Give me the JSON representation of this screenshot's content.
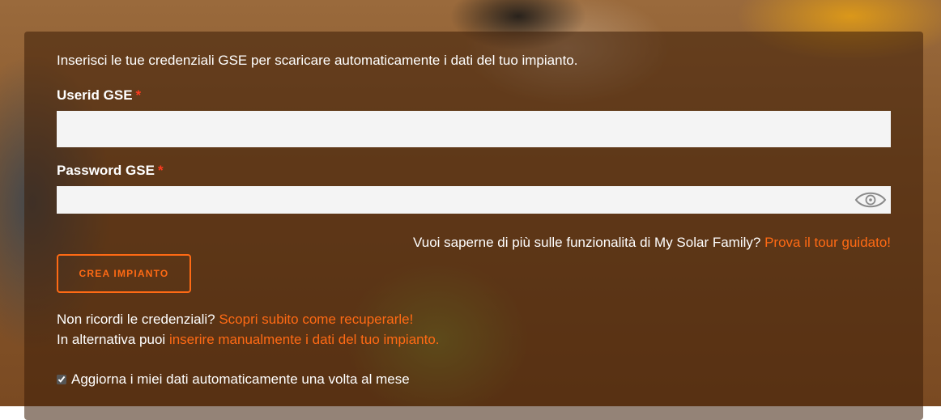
{
  "form": {
    "intro": "Inserisci le tue credenziali GSE per scaricare automaticamente i dati del tuo impianto.",
    "userid": {
      "label": "Userid GSE",
      "required_mark": "*",
      "value": ""
    },
    "password": {
      "label": "Password GSE",
      "required_mark": "*",
      "value": "",
      "toggle_icon": "eye-icon"
    },
    "tour": {
      "text": "Vuoi saperne di più sulle funzionalità di My Solar Family?",
      "link": "Prova il tour guidato!"
    },
    "submit_label": "CREA IMPIANTO",
    "recover": {
      "text": "Non ricordi le credenziali?",
      "link": "Scopri subito come recuperarle!"
    },
    "manual": {
      "text": "In alternativa puoi",
      "link": "inserire manualmente i dati del tuo impianto."
    },
    "auto_update": {
      "label": "Aggiorna i miei dati automaticamente una volta al mese",
      "checked": true
    }
  },
  "colors": {
    "accent": "#ff6a14",
    "required": "#ff3b1f",
    "text": "#ffffff",
    "input_bg": "#f4f4f4"
  }
}
